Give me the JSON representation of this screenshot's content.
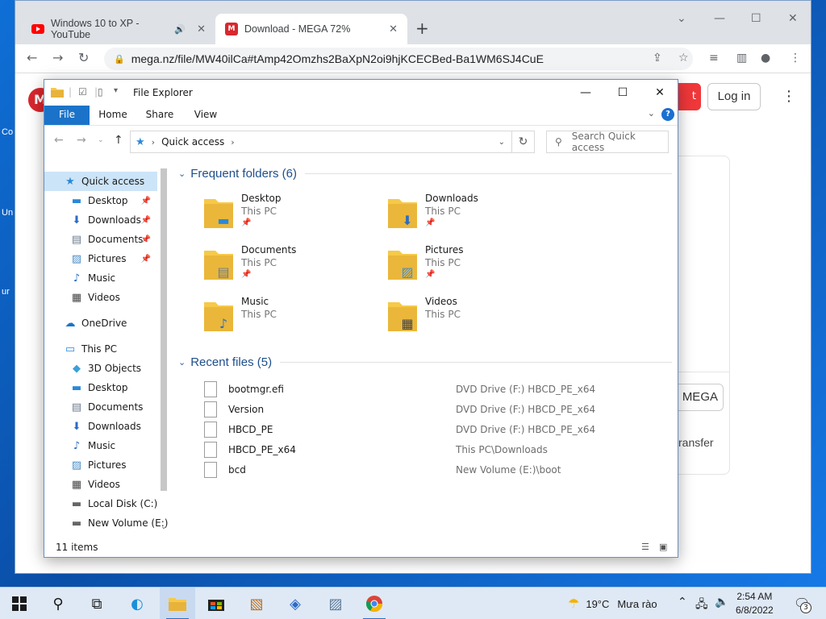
{
  "desktop": {
    "side_labels": [
      "Co",
      "Un",
      "ur"
    ]
  },
  "browser": {
    "tabs": [
      {
        "title": "Windows 10 to XP - YouTube",
        "icon": "youtube-icon"
      },
      {
        "title": "Download - MEGA 72%",
        "icon": "mega-icon"
      }
    ],
    "url": "mega.nz/file/MW40ilCa#tAmp42Omzhs2BaXpN2oi9hjKCECBed-Ba1WM6SJ4CuE"
  },
  "mega_page": {
    "logo": "M",
    "red_button_partial": "t",
    "login": "Log in",
    "mega_button_partial": "MEGA",
    "transfer_partial": "ransfer"
  },
  "explorer": {
    "title": "File Explorer",
    "ribbon_tabs": [
      "File",
      "Home",
      "Share",
      "View"
    ],
    "address": "Quick access",
    "search_placeholder": "Search Quick access",
    "nav": [
      {
        "label": "Quick access",
        "icon": "star",
        "pinned": false,
        "selected": true,
        "indent": 0
      },
      {
        "label": "Desktop",
        "icon": "desktop",
        "pinned": true,
        "indent": 1
      },
      {
        "label": "Downloads",
        "icon": "download",
        "pinned": true,
        "indent": 1
      },
      {
        "label": "Documents",
        "icon": "document",
        "pinned": true,
        "indent": 1
      },
      {
        "label": "Pictures",
        "icon": "picture",
        "pinned": true,
        "indent": 1
      },
      {
        "label": "Music",
        "icon": "music",
        "pinned": false,
        "indent": 1
      },
      {
        "label": "Videos",
        "icon": "video",
        "pinned": false,
        "indent": 1
      },
      {
        "label": "OneDrive",
        "icon": "cloud",
        "pinned": false,
        "indent": 0
      },
      {
        "label": "This PC",
        "icon": "computer",
        "pinned": false,
        "indent": 0
      },
      {
        "label": "3D Objects",
        "icon": "cube",
        "pinned": false,
        "indent": 1
      },
      {
        "label": "Desktop",
        "icon": "desktop",
        "pinned": false,
        "indent": 1
      },
      {
        "label": "Documents",
        "icon": "document",
        "pinned": false,
        "indent": 1
      },
      {
        "label": "Downloads",
        "icon": "download",
        "pinned": false,
        "indent": 1
      },
      {
        "label": "Music",
        "icon": "music",
        "pinned": false,
        "indent": 1
      },
      {
        "label": "Pictures",
        "icon": "picture",
        "pinned": false,
        "indent": 1
      },
      {
        "label": "Videos",
        "icon": "video",
        "pinned": false,
        "indent": 1
      },
      {
        "label": "Local Disk (C:)",
        "icon": "drive",
        "pinned": false,
        "indent": 1
      },
      {
        "label": "New Volume (E:)",
        "icon": "drive",
        "pinned": false,
        "indent": 1
      }
    ],
    "frequent_title": "Frequent folders (6)",
    "frequent": [
      {
        "name": "Desktop",
        "location": "This PC",
        "pinned": true,
        "overlay": "desktop"
      },
      {
        "name": "Downloads",
        "location": "This PC",
        "pinned": true,
        "overlay": "download"
      },
      {
        "name": "Documents",
        "location": "This PC",
        "pinned": true,
        "overlay": "document"
      },
      {
        "name": "Pictures",
        "location": "This PC",
        "pinned": true,
        "overlay": "picture"
      },
      {
        "name": "Music",
        "location": "This PC",
        "pinned": false,
        "overlay": "music"
      },
      {
        "name": "Videos",
        "location": "This PC",
        "pinned": false,
        "overlay": "video"
      }
    ],
    "recent_title": "Recent files (5)",
    "recent": [
      {
        "name": "bootmgr.efi",
        "location": "DVD Drive (F:) HBCD_PE_x64"
      },
      {
        "name": "Version",
        "location": "DVD Drive (F:) HBCD_PE_x64"
      },
      {
        "name": "HBCD_PE",
        "location": "DVD Drive (F:) HBCD_PE_x64"
      },
      {
        "name": "HBCD_PE_x64",
        "location": "This PC\\Downloads"
      },
      {
        "name": "bcd",
        "location": "New Volume (E:)\\boot"
      }
    ],
    "status": "11 items"
  },
  "taskbar": {
    "weather_temp": "19°C",
    "weather_desc": "Mưa rào",
    "time": "2:54 AM",
    "date": "6/8/2022",
    "notifications": "3"
  },
  "colors": {
    "accent": "#1a73c9",
    "selection": "#cce4f7",
    "folder": "#f7c948",
    "mega_red": "#d9272e"
  }
}
